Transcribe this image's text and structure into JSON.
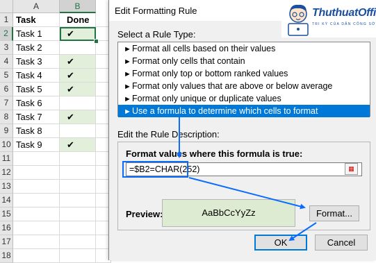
{
  "sheet": {
    "columns": [
      "A",
      "B"
    ],
    "headers": {
      "task": "Task",
      "done": "Done"
    },
    "rows": [
      {
        "num": "1"
      },
      {
        "num": "2",
        "task": "Task 1",
        "done": "✔"
      },
      {
        "num": "3",
        "task": "Task 2",
        "done": ""
      },
      {
        "num": "4",
        "task": "Task 3",
        "done": "✔"
      },
      {
        "num": "5",
        "task": "Task 4",
        "done": "✔"
      },
      {
        "num": "6",
        "task": "Task 5",
        "done": "✔"
      },
      {
        "num": "7",
        "task": "Task 6",
        "done": ""
      },
      {
        "num": "8",
        "task": "Task 7",
        "done": "✔"
      },
      {
        "num": "9",
        "task": "Task 8",
        "done": ""
      },
      {
        "num": "10",
        "task": "Task 9",
        "done": "✔"
      },
      {
        "num": "11"
      },
      {
        "num": "12"
      },
      {
        "num": "13"
      },
      {
        "num": "14"
      },
      {
        "num": "15"
      },
      {
        "num": "16"
      },
      {
        "num": "17"
      },
      {
        "num": "18"
      }
    ],
    "highlight_color": "#e2efda",
    "accent_color": "#217346"
  },
  "dialog": {
    "title": "Edit Formatting Rule",
    "help_label": "?",
    "close_label": "✕",
    "select_type_label": "Select a Rule Type:",
    "rule_types": [
      "Format all cells based on their values",
      "Format only cells that contain",
      "Format only top or bottom ranked values",
      "Format only values that are above or below average",
      "Format only unique or duplicate values",
      "Use a formula to determine which cells to format"
    ],
    "rule_bullet": "►",
    "selected_rule_index": 5,
    "edit_desc_label": "Edit the Rule Description:",
    "formula_label": "Format values where this formula is true:",
    "formula_value": "=$B2=CHAR(252)",
    "preview_label": "Preview:",
    "preview_text": "AaBbCcYyZz",
    "format_button": "Format...",
    "ok_button": "OK",
    "cancel_button": "Cancel",
    "selection_color": "#0078d7",
    "annotation_color": "#0a6cff"
  },
  "logo": {
    "name": "ThuthuatOffice",
    "tagline": "TRI KỲ CỦA DÂN CÔNG SỞ"
  }
}
